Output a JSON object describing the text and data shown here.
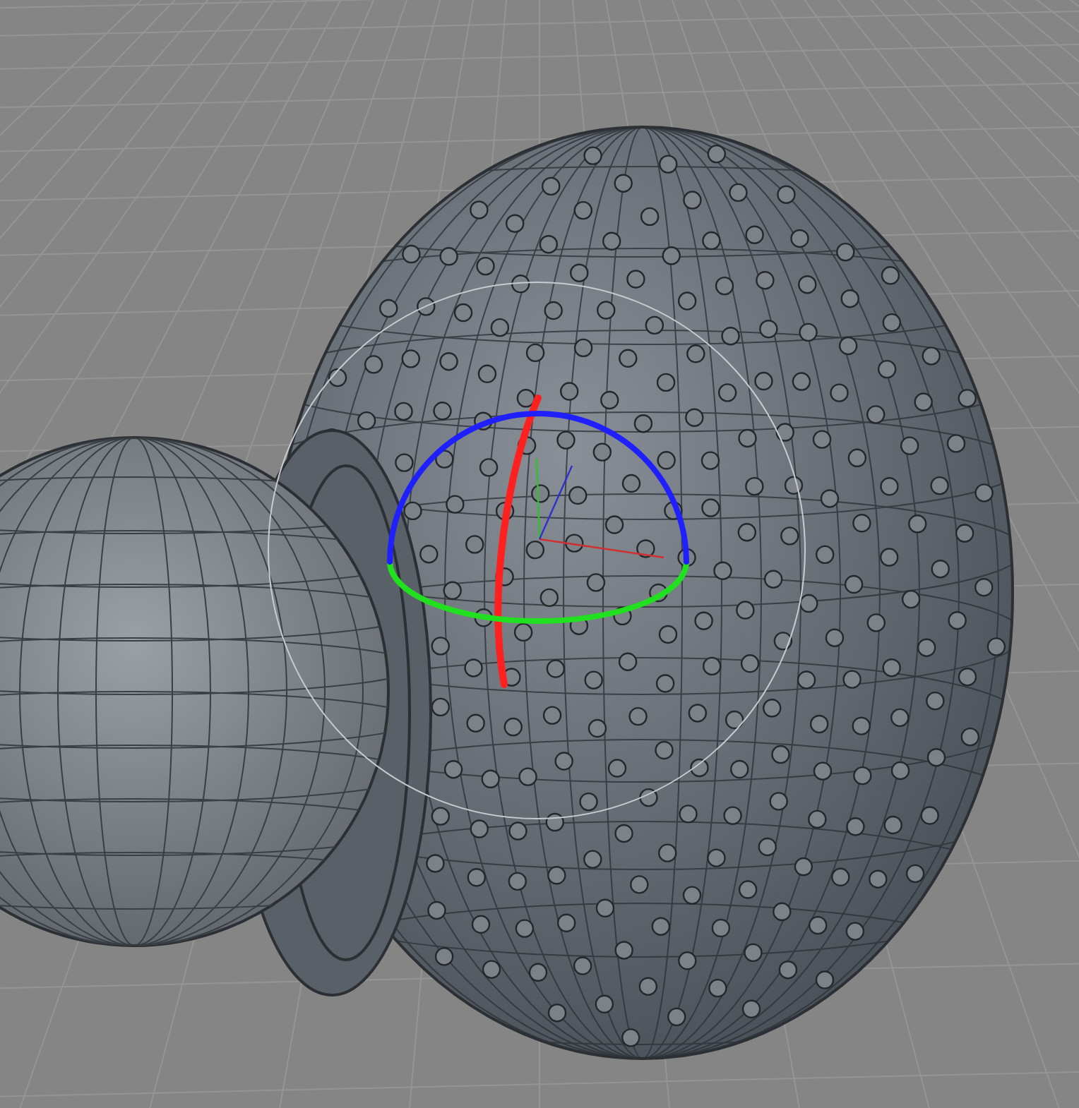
{
  "viewport": {
    "gizmo_rings": [
      {
        "color": "#ff2020"
      },
      {
        "color": "#20e020"
      },
      {
        "color": "#2020ff"
      }
    ]
  }
}
